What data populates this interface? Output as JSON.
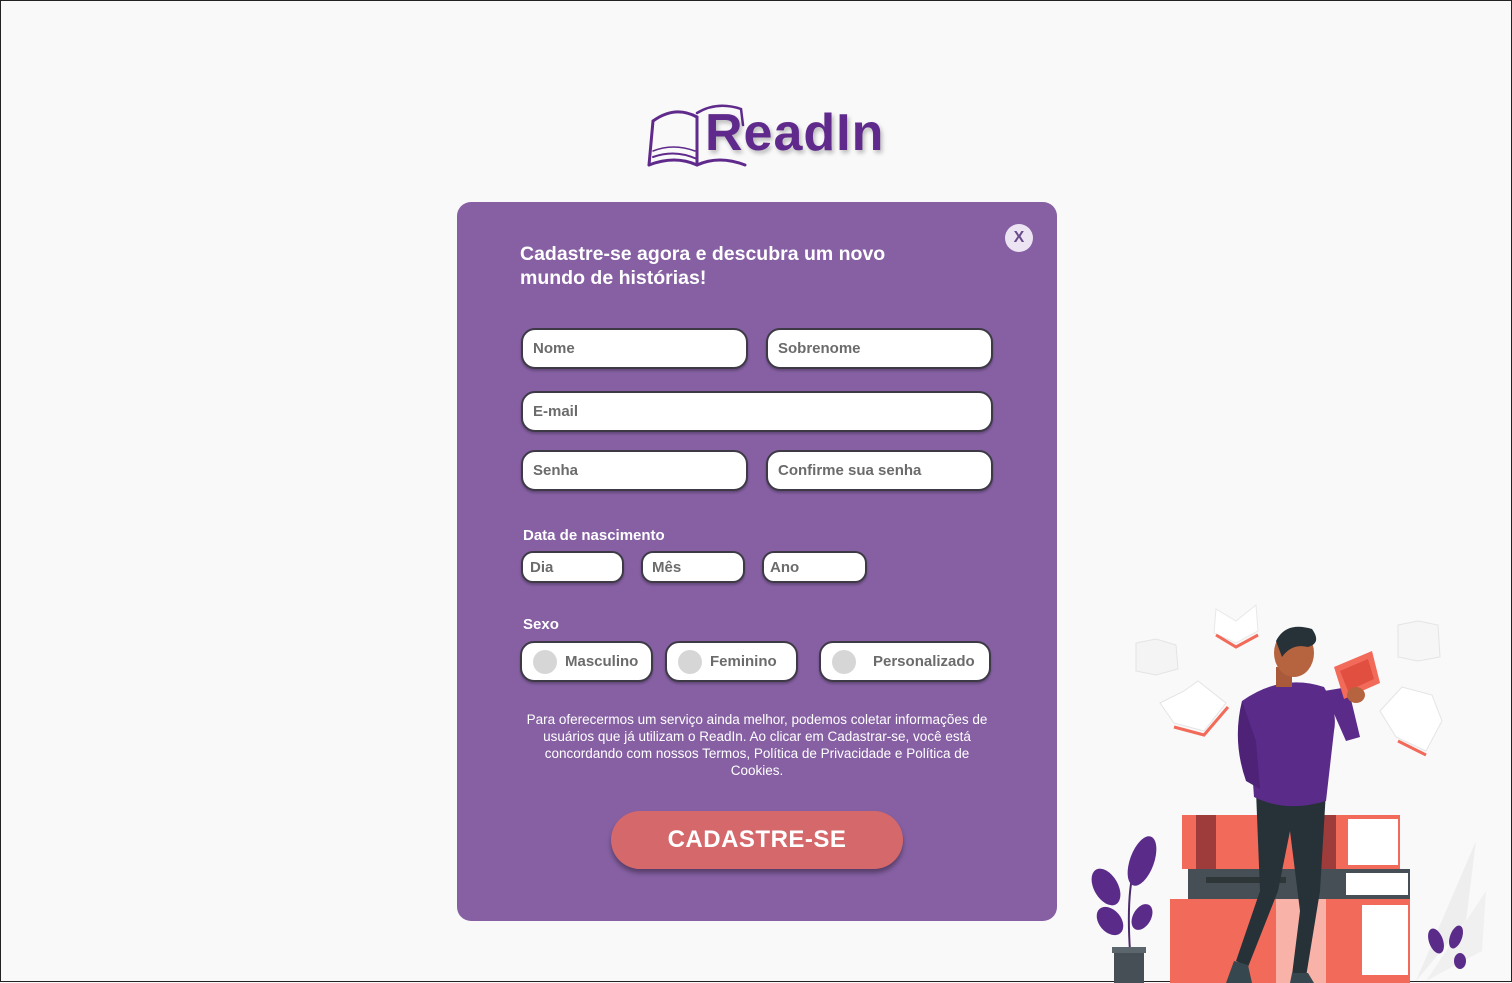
{
  "logo": {
    "text": "ReadIn",
    "icon": "open-book-icon"
  },
  "form": {
    "title": "Cadastre-se agora e descubra um novo mundo de histórias!",
    "close_label": "X",
    "fields": {
      "first_name": "Nome",
      "last_name": "Sobrenome",
      "email": "E-mail",
      "password": "Senha",
      "confirm_password": "Confirme sua senha"
    },
    "birth_date": {
      "label": "Data de nascimento",
      "day": "Dia",
      "month": "Mês",
      "year": "Ano"
    },
    "gender": {
      "label": "Sexo",
      "options": [
        "Masculino",
        "Feminino",
        "Personalizado"
      ]
    },
    "terms": "Para oferecermos um serviço ainda melhor, podemos coletar informações de usuários que já utilizam o ReadIn. Ao clicar em Cadastrar-se, você está concordando com nossos Termos, Política de Privacidade e Política de Cookies.",
    "submit_label": "CADASTRE-SE"
  },
  "colors": {
    "card": "#8660a3",
    "brand": "#5f2a8c",
    "submit": "#d5686a",
    "background": "#f9f9f9"
  },
  "illustration": "man-reading-books-illustration"
}
